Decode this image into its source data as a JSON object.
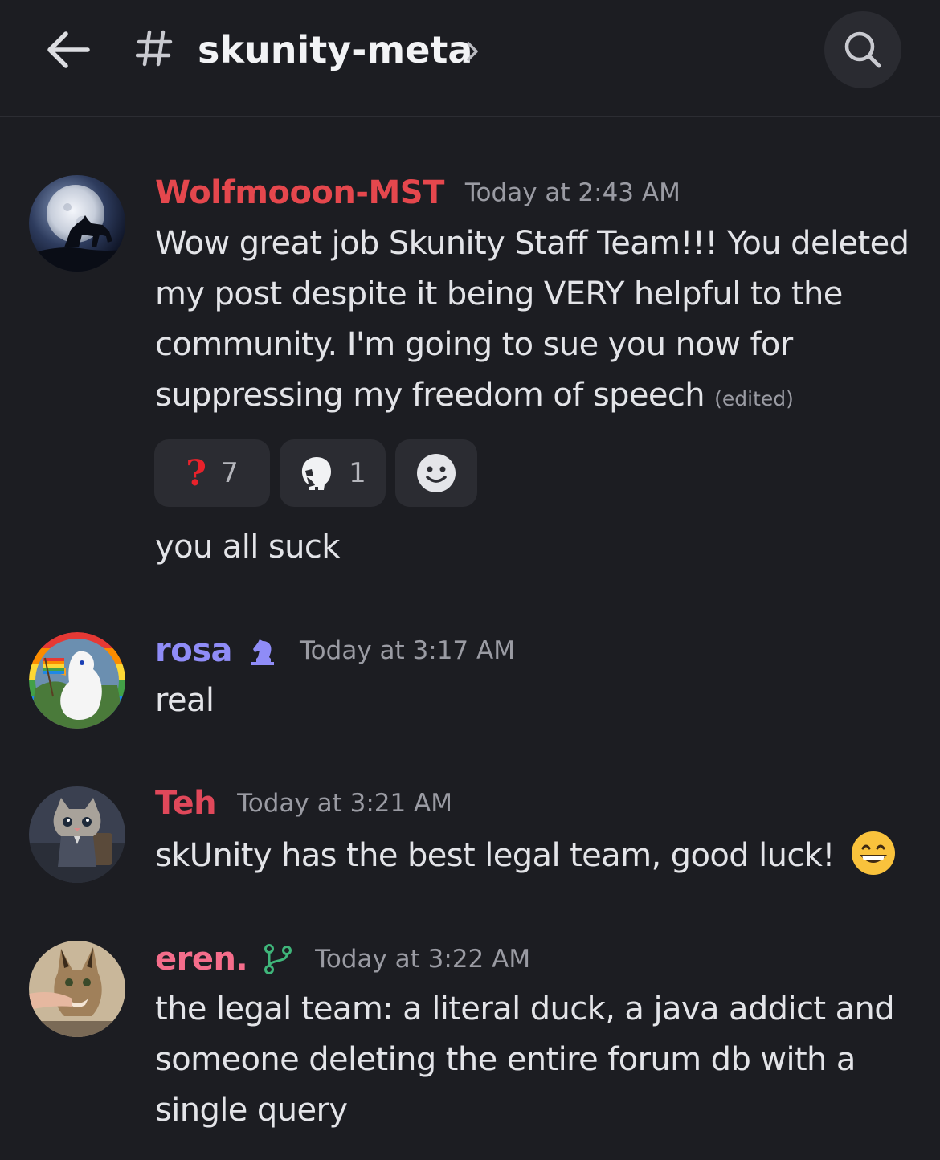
{
  "header": {
    "channel_name": "skunity-meta",
    "back_icon": "arrow-left-icon",
    "hash_icon": "hash-icon",
    "chevron_icon": "chevron-right-icon",
    "search_icon": "search-icon"
  },
  "messages": [
    {
      "author": "Wolfmooon-MST",
      "author_color": "#e5474d",
      "timestamp": "Today at 2:43 AM",
      "text": "Wow great job Skunity Staff Team!!! You deleted my post despite it being VERY helpful to the community. I'm going to sue you now for suppressing my freedom of speech",
      "edited_label": "(edited)",
      "reactions": [
        {
          "emoji": "question-mark-icon",
          "count": "7"
        },
        {
          "emoji": "skull-icon",
          "count": "1"
        }
      ],
      "add_reaction_icon": "add-reaction-icon",
      "followup_text": "you all suck"
    },
    {
      "author": "rosa",
      "author_color": "#8f8cf7",
      "role_icon": "chess-knight-icon",
      "timestamp": "Today at 3:17 AM",
      "text": "real"
    },
    {
      "author": "Teh",
      "author_color": "#e0485a",
      "timestamp": "Today at 3:21 AM",
      "text": "skUnity has the best legal team, good luck!",
      "trailing_emoji": "grinning-face-icon"
    },
    {
      "author": "eren.",
      "author_color": "#f56d8b",
      "role_icon": "git-branch-icon",
      "timestamp": "Today at 3:22 AM",
      "text": "the legal team: a literal duck, a java addict and someone deleting the entire forum db with a single query"
    }
  ]
}
